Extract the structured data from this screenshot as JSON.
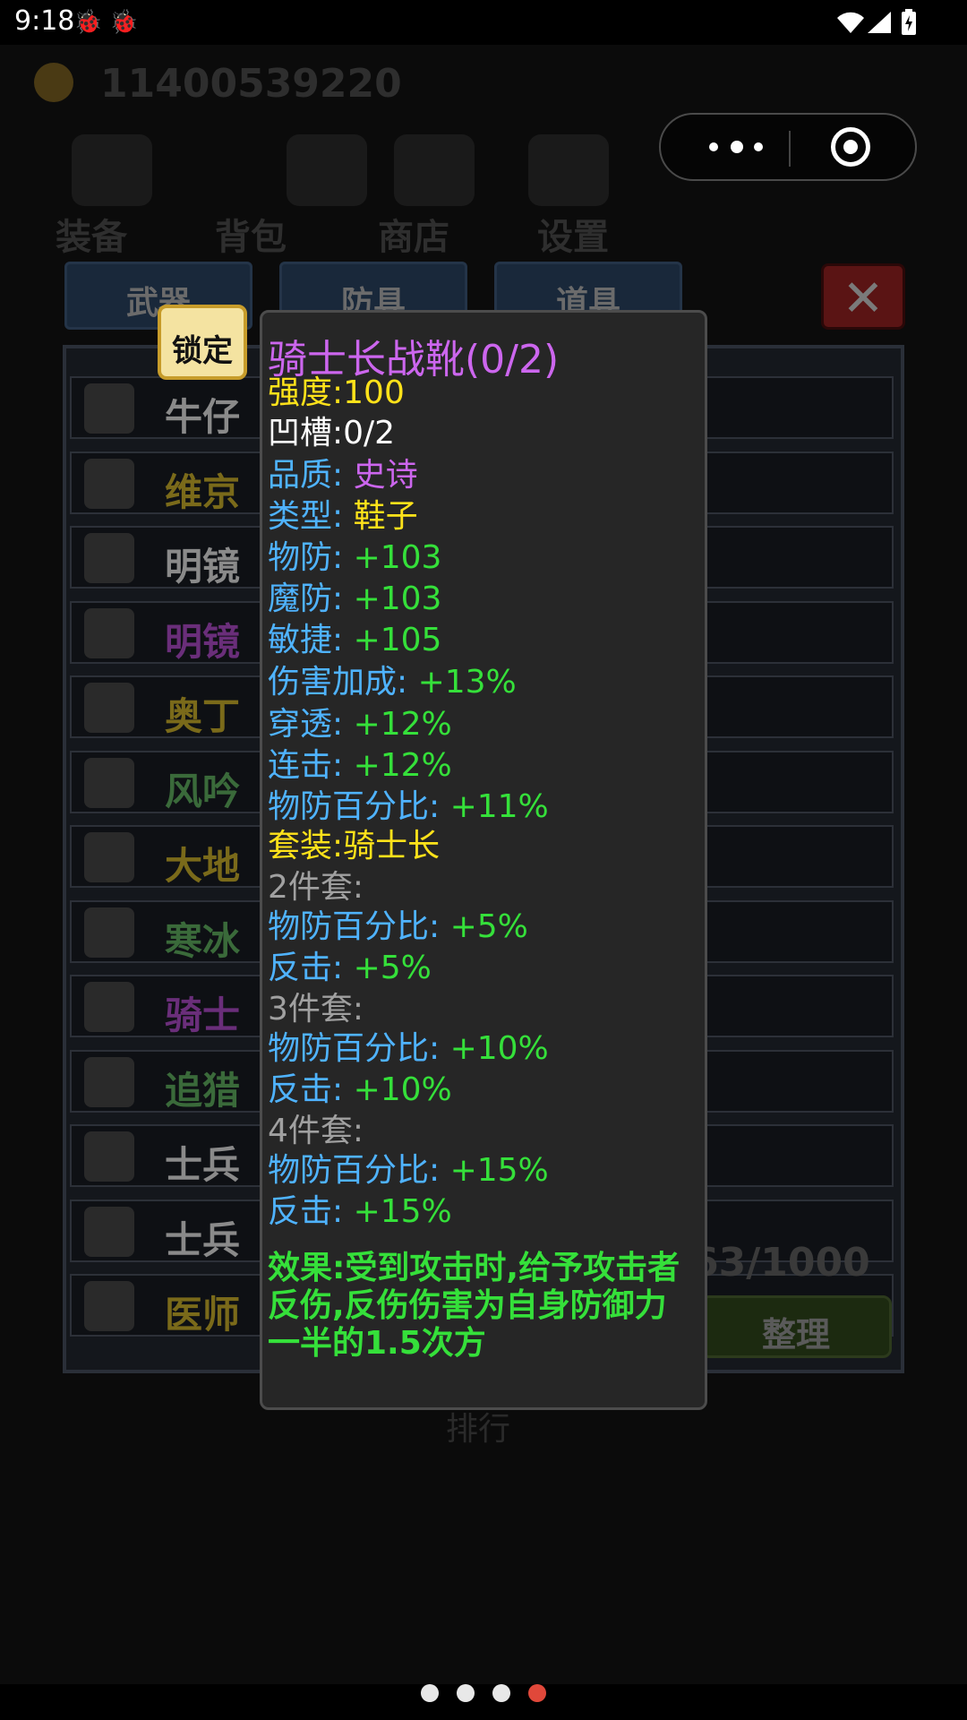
{
  "status_bar": {
    "time": "9:18",
    "notif_icons": [
      "bug-icon",
      "bug-icon"
    ],
    "right_icons": [
      "wifi-icon",
      "signal-icon",
      "battery-charging-icon"
    ]
  },
  "game": {
    "coins": "11400539220",
    "menu_tabs": [
      "装备",
      "背包",
      "商店",
      "设置"
    ],
    "inventory_tabs": [
      "武器",
      "防具",
      "道具"
    ],
    "close_label": "✕",
    "lock_label": "锁定",
    "items": [
      {
        "name": "牛仔",
        "color": "#8a8a8a"
      },
      {
        "name": "维京",
        "color": "#7a6a1a"
      },
      {
        "name": "明镜",
        "color": "#8a8a8a"
      },
      {
        "name": "明镜",
        "color": "#6a2e7a"
      },
      {
        "name": "奥丁",
        "color": "#7a6a1a"
      },
      {
        "name": "风吟",
        "color": "#3a6a3a"
      },
      {
        "name": "大地",
        "color": "#7a6a1a"
      },
      {
        "name": "寒冰",
        "color": "#3a6a3a"
      },
      {
        "name": "骑士",
        "color": "#6a2e7a"
      },
      {
        "name": "追猎",
        "color": "#3a6a3a"
      },
      {
        "name": "士兵",
        "color": "#8a8a8a"
      },
      {
        "name": "士兵",
        "color": "#8a8a8a"
      },
      {
        "name": "医师",
        "color": "#7a6a1a"
      }
    ],
    "bag_count": "63/1000",
    "sort_label": "整理",
    "bottom_text": "排行"
  },
  "tooltip": {
    "title": "骑士长战靴(0/2)",
    "strength": {
      "label": "强度:",
      "value": "100"
    },
    "slots": {
      "label": "凹槽:",
      "value": "0/2"
    },
    "quality": {
      "label": "品质: ",
      "value": "史诗"
    },
    "type": {
      "label": "类型: ",
      "value": "鞋子"
    },
    "stats": [
      {
        "label": "物防: ",
        "value": "+103"
      },
      {
        "label": "魔防: ",
        "value": "+103"
      },
      {
        "label": "敏捷: ",
        "value": "+105"
      },
      {
        "label": "伤害加成: ",
        "value": "+13%"
      },
      {
        "label": "穿透: ",
        "value": "+12%"
      },
      {
        "label": "连击: ",
        "value": "+12%"
      },
      {
        "label": "物防百分比: ",
        "value": "+11%"
      }
    ],
    "set_name": "套装:骑士长",
    "set_tiers": [
      {
        "header": "2件套:",
        "bonuses": [
          {
            "label": "物防百分比: ",
            "value": "+5%"
          },
          {
            "label": "反击: ",
            "value": "+5%"
          }
        ]
      },
      {
        "header": "3件套:",
        "bonuses": [
          {
            "label": "物防百分比: ",
            "value": "+10%"
          },
          {
            "label": "反击: ",
            "value": "+10%"
          }
        ]
      },
      {
        "header": "4件套:",
        "bonuses": [
          {
            "label": "物防百分比: ",
            "value": "+15%"
          },
          {
            "label": "反击: ",
            "value": "+15%"
          }
        ]
      }
    ],
    "effect": "效果:受到攻击时,给予攻击者反伤,反伤伤害为自身防御力一半的1.5次方"
  },
  "colors": {
    "title_purple": "#cc66ee",
    "yellow": "#ffe21a",
    "white": "#ffffff",
    "label_blue": "#4fb3ff",
    "value_green": "#35e03a",
    "epic_purple": "#cc66ee",
    "grey": "#a0a0a0"
  },
  "page_indicator": {
    "count": 4,
    "active": 4
  }
}
